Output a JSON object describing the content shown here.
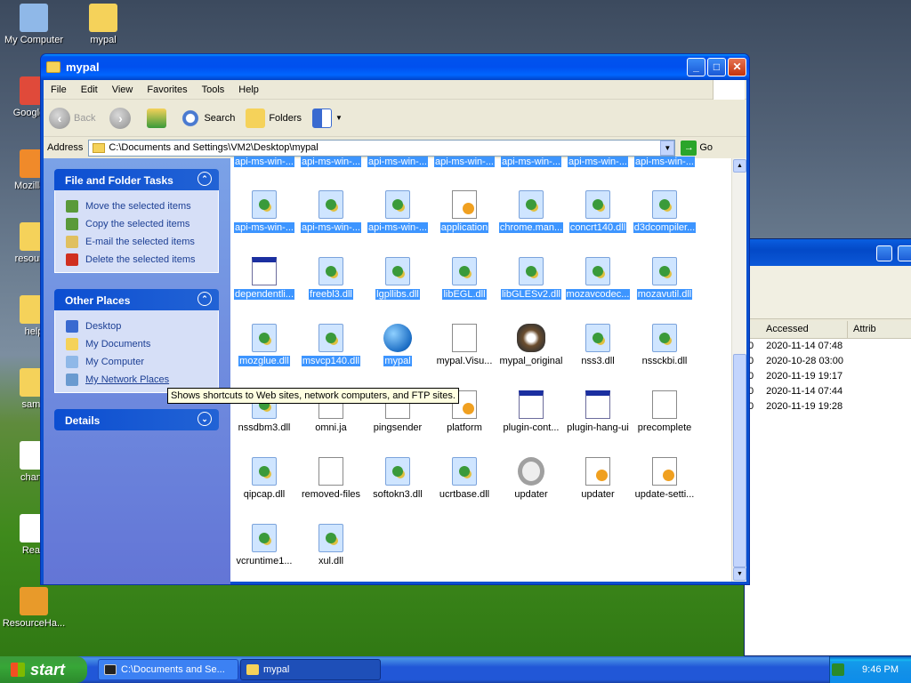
{
  "desktop": {
    "icons": [
      {
        "name": "desk-icon-my-computer",
        "label": "My Computer",
        "color": "#8fb8e8"
      },
      {
        "name": "desk-icon-mypal",
        "label": "mypal",
        "color": "#f5d25a"
      },
      {
        "name": "desk-icon-google-chrome",
        "label": "Google C",
        "color": "#e04a3a"
      },
      {
        "name": "desk-icon-mozilla-firefox",
        "label": "Mozilla F",
        "color": "#f08a2a"
      },
      {
        "name": "desk-icon-resource",
        "label": "resource",
        "color": "#f5d25a"
      },
      {
        "name": "desk-icon-help",
        "label": "help",
        "color": "#f5d25a"
      },
      {
        "name": "desk-icon-sample",
        "label": "samp",
        "color": "#f5d25a"
      },
      {
        "name": "desk-icon-changes",
        "label": "chang",
        "color": "#ffffff"
      },
      {
        "name": "desk-icon-readme",
        "label": "Read",
        "color": "#ffffff"
      },
      {
        "name": "desk-icon-resource-hacker",
        "label": "ResourceHa...",
        "color": "#e89a2a"
      }
    ]
  },
  "background_window": {
    "columns": [
      "Accessed",
      "Attrib"
    ],
    "rows": [
      "2020-11-14 07:48",
      "2020-10-28 03:00",
      "2020-11-19 19:17",
      "2020-11-14 07:44",
      "2020-11-19 19:28"
    ],
    "row_prefix": "0"
  },
  "window": {
    "title": "mypal",
    "menu": [
      "File",
      "Edit",
      "View",
      "Favorites",
      "Tools",
      "Help"
    ],
    "toolbar": {
      "back": "Back",
      "search": "Search",
      "folders": "Folders"
    },
    "address": {
      "label": "Address",
      "path": "C:\\Documents and Settings\\VM2\\Desktop\\mypal",
      "go": "Go"
    },
    "tasks": {
      "title": "File and Folder Tasks",
      "items": [
        "Move the selected items",
        "Copy the selected items",
        "E-mail the selected items",
        "Delete the selected items"
      ]
    },
    "places": {
      "title": "Other Places",
      "items": [
        "Desktop",
        "My Documents",
        "My Computer",
        "My Network Places"
      ]
    },
    "details": {
      "title": "Details"
    },
    "tooltip": "Shows shortcuts to Web sites, network computers, and FTP sites.",
    "files": [
      {
        "label": "api-ms-win-...",
        "type": "dll",
        "sel": true
      },
      {
        "label": "api-ms-win-...",
        "type": "dll",
        "sel": true
      },
      {
        "label": "api-ms-win-...",
        "type": "dll",
        "sel": true
      },
      {
        "label": "api-ms-win-...",
        "type": "dll",
        "sel": true
      },
      {
        "label": "api-ms-win-...",
        "type": "dll",
        "sel": true
      },
      {
        "label": "api-ms-win-...",
        "type": "dll",
        "sel": true
      },
      {
        "label": "api-ms-win-...",
        "type": "dll",
        "sel": true
      },
      {
        "label": "api-ms-win-...",
        "type": "dll",
        "sel": true
      },
      {
        "label": "api-ms-win-...",
        "type": "dll",
        "sel": true
      },
      {
        "label": "api-ms-win-...",
        "type": "dll",
        "sel": true
      },
      {
        "label": "application",
        "type": "gear",
        "sel": true
      },
      {
        "label": "chrome.man...",
        "type": "dll",
        "sel": true
      },
      {
        "label": "concrt140.dll",
        "type": "dll",
        "sel": true
      },
      {
        "label": "d3dcompiler...",
        "type": "dll",
        "sel": true
      },
      {
        "label": "dependentli...",
        "type": "exe",
        "sel": true
      },
      {
        "label": "freebl3.dll",
        "type": "dll",
        "sel": true
      },
      {
        "label": "lgpllibs.dll",
        "type": "dll",
        "sel": true
      },
      {
        "label": "libEGL.dll",
        "type": "dll",
        "sel": true
      },
      {
        "label": "libGLESv2.dll",
        "type": "dll",
        "sel": true
      },
      {
        "label": "mozavcodec...",
        "type": "dll",
        "sel": true
      },
      {
        "label": "mozavutil.dll",
        "type": "dll",
        "sel": true
      },
      {
        "label": "mozglue.dll",
        "type": "dll",
        "sel": true
      },
      {
        "label": "msvcp140.dll",
        "type": "dll",
        "sel": true
      },
      {
        "label": "mypal",
        "type": "globe",
        "sel": true
      },
      {
        "label": "mypal.Visu...",
        "type": "gen",
        "sel": false
      },
      {
        "label": "mypal_original",
        "type": "raccoon",
        "sel": false
      },
      {
        "label": "nss3.dll",
        "type": "dll",
        "sel": false
      },
      {
        "label": "nssckbi.dll",
        "type": "dll",
        "sel": false
      },
      {
        "label": "nssdbm3.dll",
        "type": "dll",
        "sel": false
      },
      {
        "label": "omni.ja",
        "type": "gen",
        "sel": false
      },
      {
        "label": "pingsender",
        "type": "gen",
        "sel": false
      },
      {
        "label": "platform",
        "type": "gear",
        "sel": false
      },
      {
        "label": "plugin-cont...",
        "type": "exe",
        "sel": false
      },
      {
        "label": "plugin-hang-ui",
        "type": "exe",
        "sel": false
      },
      {
        "label": "precomplete",
        "type": "gen",
        "sel": false
      },
      {
        "label": "qipcap.dll",
        "type": "dll",
        "sel": false
      },
      {
        "label": "removed-files",
        "type": "gen",
        "sel": false
      },
      {
        "label": "softokn3.dll",
        "type": "dll",
        "sel": false
      },
      {
        "label": "ucrtbase.dll",
        "type": "dll",
        "sel": false
      },
      {
        "label": "updater",
        "type": "upd",
        "sel": false
      },
      {
        "label": "updater",
        "type": "gear",
        "sel": false
      },
      {
        "label": "update-setti...",
        "type": "gear",
        "sel": false
      },
      {
        "label": "vcruntime1...",
        "type": "dll",
        "sel": false
      },
      {
        "label": "xul.dll",
        "type": "dll",
        "sel": false
      }
    ]
  },
  "taskbar": {
    "start": "start",
    "items": [
      {
        "label": "C:\\Documents and Se...",
        "active": false
      },
      {
        "label": "mypal",
        "active": true
      }
    ],
    "clock": "9:46 PM"
  }
}
